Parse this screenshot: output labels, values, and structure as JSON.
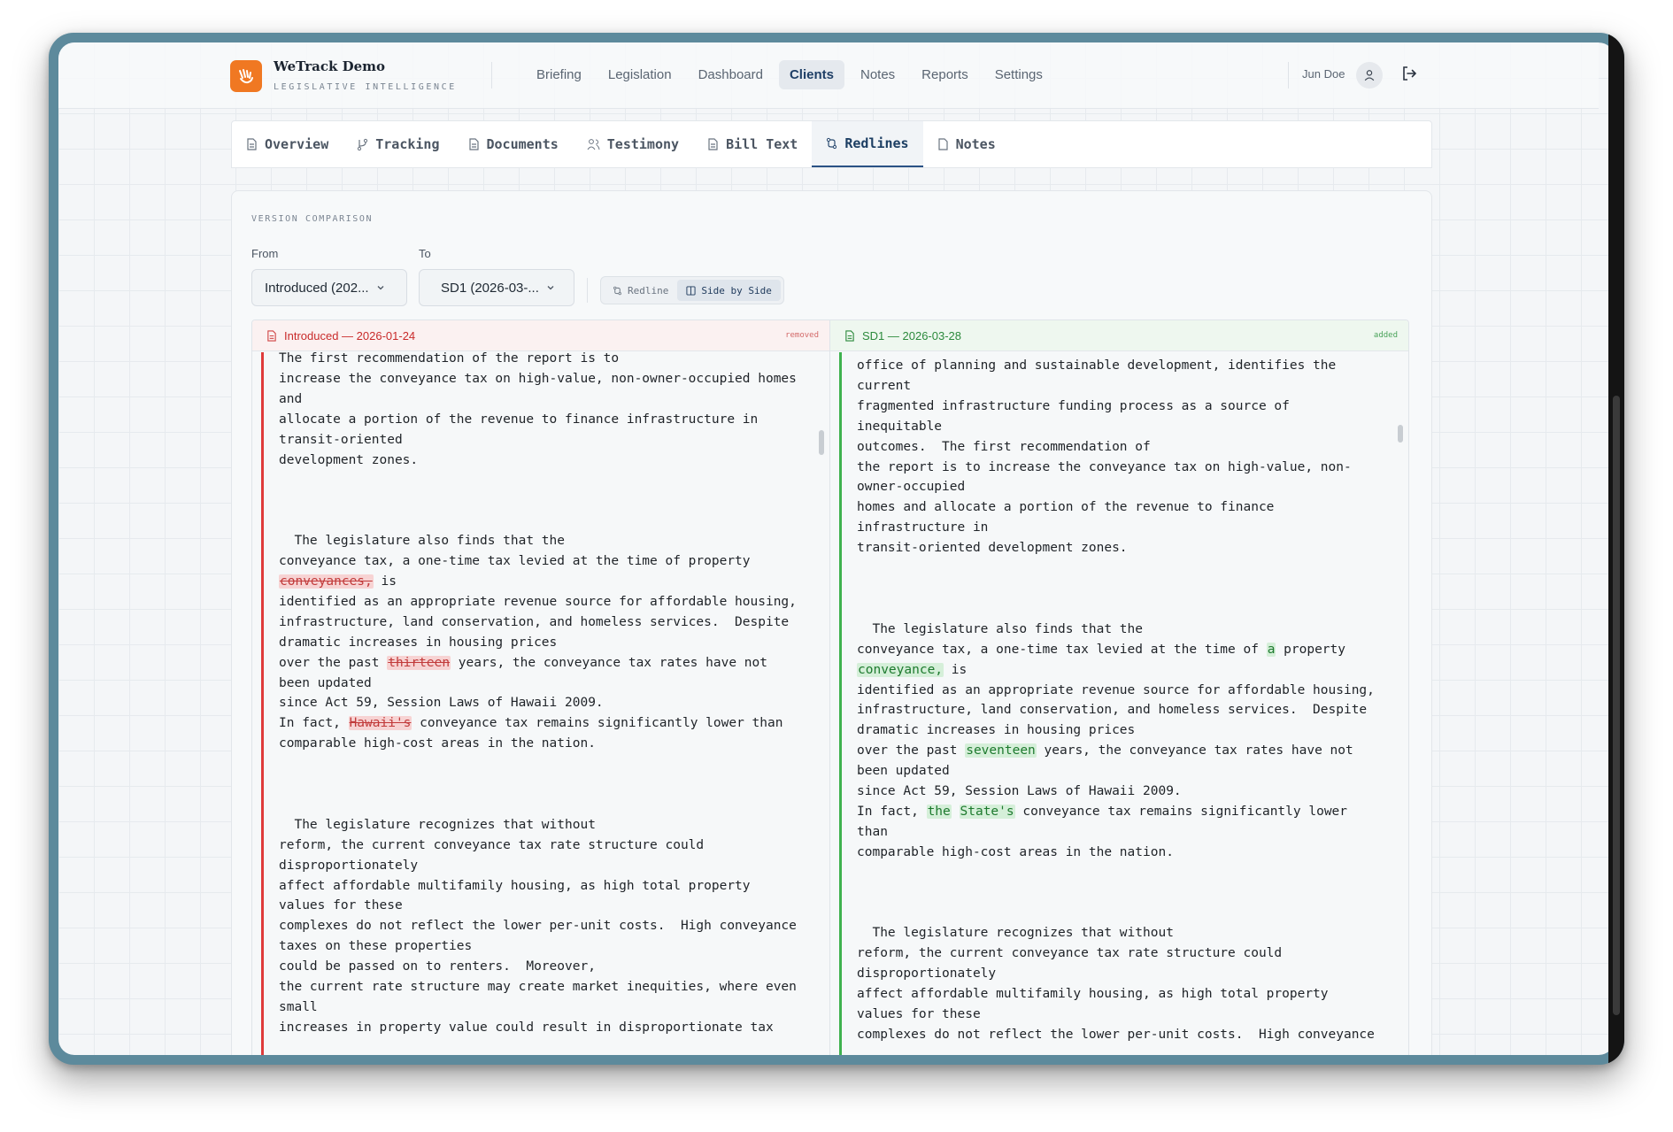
{
  "app": {
    "name": "WeTrack Demo",
    "tagline": "LEGISLATIVE INTELLIGENCE",
    "brand_color": "#f07822"
  },
  "nav": {
    "items": [
      {
        "label": "Briefing",
        "active": false
      },
      {
        "label": "Legislation",
        "active": false
      },
      {
        "label": "Dashboard",
        "active": false
      },
      {
        "label": "Clients",
        "active": true
      },
      {
        "label": "Notes",
        "active": false
      },
      {
        "label": "Reports",
        "active": false
      },
      {
        "label": "Settings",
        "active": false
      }
    ]
  },
  "user": {
    "name": "Jun Doe"
  },
  "tabs": [
    {
      "label": "Overview",
      "icon": "document-icon",
      "active": false
    },
    {
      "label": "Tracking",
      "icon": "git-branch-icon",
      "active": false
    },
    {
      "label": "Documents",
      "icon": "document-icon",
      "active": false
    },
    {
      "label": "Testimony",
      "icon": "users-icon",
      "active": false
    },
    {
      "label": "Bill Text",
      "icon": "document-icon",
      "active": false
    },
    {
      "label": "Redlines",
      "icon": "git-compare-icon",
      "active": true
    },
    {
      "label": "Notes",
      "icon": "file-icon",
      "active": false
    }
  ],
  "comparison": {
    "section_label": "VERSION COMPARISON",
    "from_label": "From",
    "from_value": "Introduced (202...",
    "to_label": "To",
    "to_value": "SD1 (2026-03-...",
    "view_modes": [
      {
        "label": "Redline",
        "active": false
      },
      {
        "label": "Side by Side",
        "active": true
      }
    ]
  },
  "left_pane": {
    "title": "Introduced — 2026-01-24",
    "tag": "removed",
    "accent": "#df3b3b"
  },
  "right_pane": {
    "title": "SD1 — 2026-03-28",
    "tag": "added",
    "accent": "#3fb24f"
  }
}
